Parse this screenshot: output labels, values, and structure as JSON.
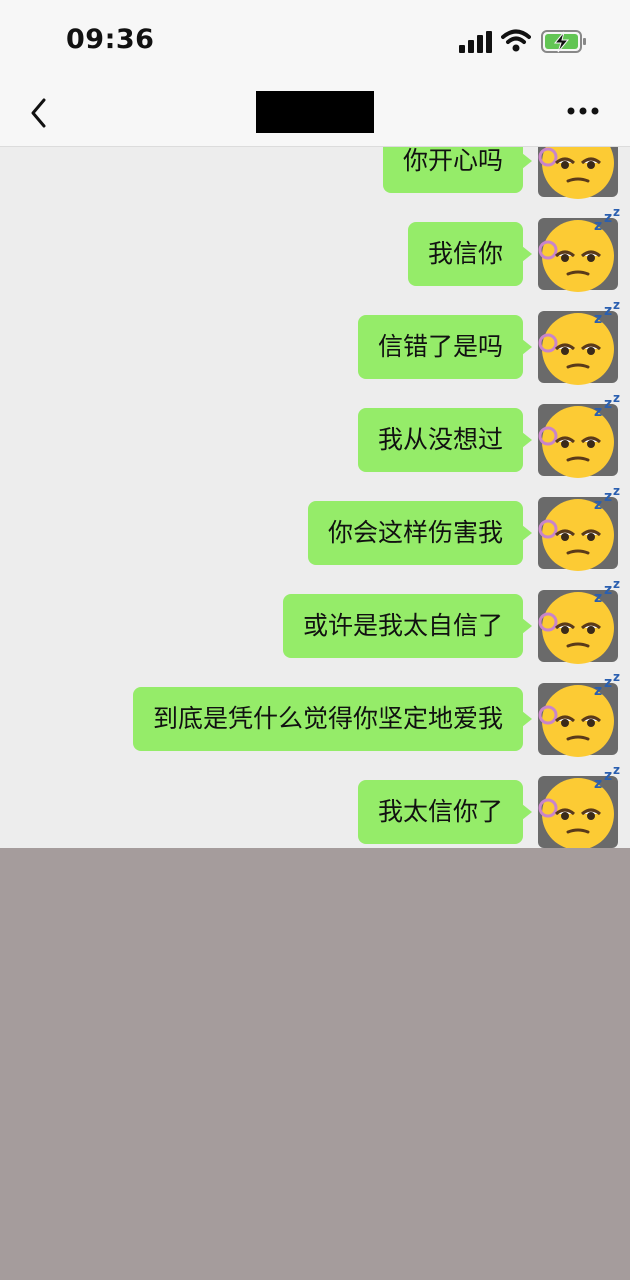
{
  "status_bar": {
    "time": "09:36"
  },
  "nav": {
    "contact_name": ""
  },
  "messages": [
    {
      "text": "你开心吗"
    },
    {
      "text": "我信你"
    },
    {
      "text": "信错了是吗"
    },
    {
      "text": "我从没想过"
    },
    {
      "text": "你会这样伤害我"
    },
    {
      "text": "或许是我太自信了"
    },
    {
      "text": "到底是凭什么觉得你坚定地爱我"
    },
    {
      "text": "我太信你了"
    }
  ],
  "colors": {
    "bubble": "#95ec69",
    "chat_background": "#ededed",
    "battery_fill": "#62c554",
    "bottom_area": "#a59c9c"
  },
  "icons": {
    "back": "chevron-left-icon",
    "more": "more-dots-icon",
    "avatar": "sleepy-face-emoji"
  }
}
